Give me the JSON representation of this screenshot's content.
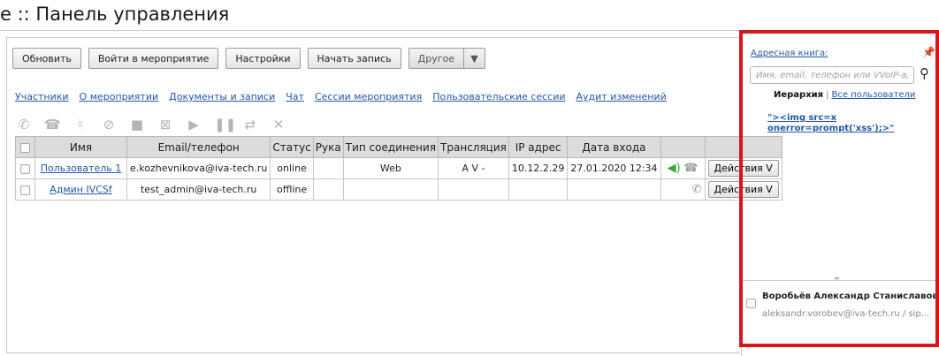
{
  "page": {
    "title": "е :: Панель управления"
  },
  "toolbar": {
    "refresh": "Обновить",
    "enter_event": "Войти в мероприятие",
    "settings": "Настройки",
    "start_recording": "Начать запись",
    "other": "Другое",
    "other_arrow": "▼"
  },
  "tabs": [
    {
      "label": "Участники"
    },
    {
      "label": "О мероприятии"
    },
    {
      "label": "Документы и записи"
    },
    {
      "label": "Чат"
    },
    {
      "label": "Сессии мероприятия"
    },
    {
      "label": "Пользовательские сессии"
    },
    {
      "label": "Аудит изменений"
    }
  ],
  "action_icons": [
    "phone-add-icon",
    "phone-hangup-icon",
    "microphone-icon",
    "microphone-off-icon",
    "video-icon",
    "video-off-icon",
    "play-icon",
    "pause-icon",
    "transfer-user-icon",
    "close-icon"
  ],
  "table": {
    "headers": {
      "name": "Имя",
      "email": "Email/телефон",
      "status": "Статус",
      "hand": "Рука",
      "connection": "Тип соединения",
      "broadcast": "Трансляция",
      "ip": "IP адрес",
      "date": "Дата входа"
    },
    "rows": [
      {
        "name": "Пользователь 1",
        "email": "e.kozhevnikova@iva-tech.ru",
        "status": "online",
        "hand": "",
        "connection": "Web",
        "broadcast": "A V -",
        "ip": "10.12.2.29",
        "date": "27.01.2020 12:34",
        "actions": "Действия V"
      },
      {
        "name": "Админ IVCSf",
        "email": "test_admin@iva-tech.ru",
        "status": "offline",
        "hand": "",
        "connection": "",
        "broadcast": "",
        "ip": "",
        "date": "",
        "actions": "Действия V"
      }
    ]
  },
  "side_panel": {
    "address_book": "Адресная книга:",
    "search_placeholder": "Имя, email, телефон или VVoIP-ад",
    "hierarchy": "Иерархия",
    "separator": "|",
    "all_users": "Все пользователи",
    "tree_item": "\"><img src=x onerror=prompt('xss');>\"",
    "contact": {
      "name": "Воробьёв Александр Станиславов...",
      "detail": "aleksandr.vorobev@iva-tech.ru / sip..."
    }
  },
  "colors": {
    "link": "#2456a6",
    "highlight": "#d4161f",
    "header_bg": "#dcdcdc",
    "online_icon": "#3aa83a"
  }
}
